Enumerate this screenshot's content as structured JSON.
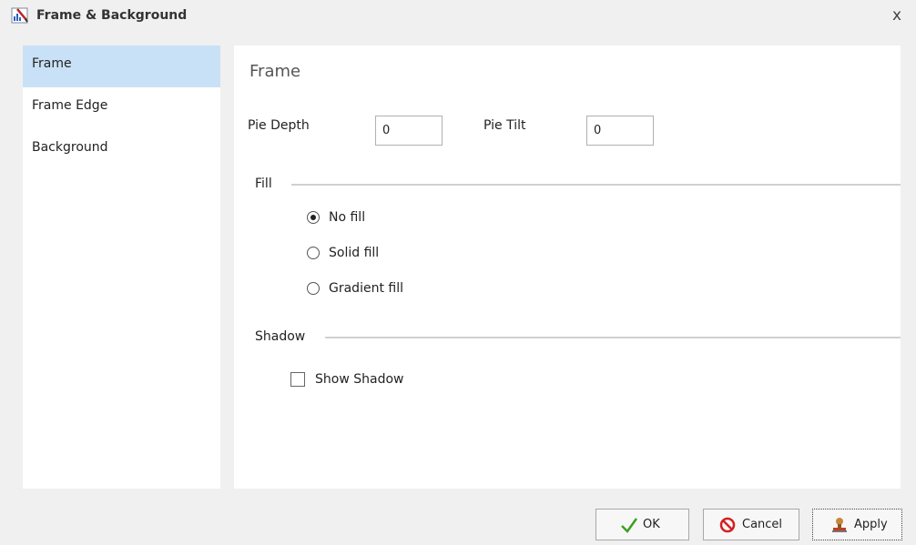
{
  "window": {
    "title": "Frame & Background",
    "icon": "chart-pencil-icon",
    "close_label": "x"
  },
  "nav": {
    "items": [
      {
        "label": "Frame",
        "active": true
      },
      {
        "label": "Frame Edge",
        "active": false
      },
      {
        "label": "Background",
        "active": false
      }
    ]
  },
  "panel": {
    "title": "Frame",
    "pie_depth": {
      "label": "Pie Depth",
      "value": "0"
    },
    "pie_tilt": {
      "label": "Pie Tilt",
      "value": "0"
    },
    "fill": {
      "label": "Fill",
      "options": [
        {
          "label": "No fill",
          "checked": true
        },
        {
          "label": "Solid fill",
          "checked": false
        },
        {
          "label": "Gradient fill",
          "checked": false
        }
      ]
    },
    "shadow": {
      "label": "Shadow",
      "show_shadow": {
        "label": "Show Shadow",
        "checked": false
      }
    }
  },
  "buttons": {
    "ok": {
      "label": "OK",
      "icon": "checkmark-icon"
    },
    "cancel": {
      "label": "Cancel",
      "icon": "cancel-icon"
    },
    "apply": {
      "label": "Apply",
      "icon": "stamp-icon"
    }
  },
  "colors": {
    "nav_active": "#c9e1f6",
    "ok_check": "#3aa020",
    "cancel_red": "#d42020"
  }
}
